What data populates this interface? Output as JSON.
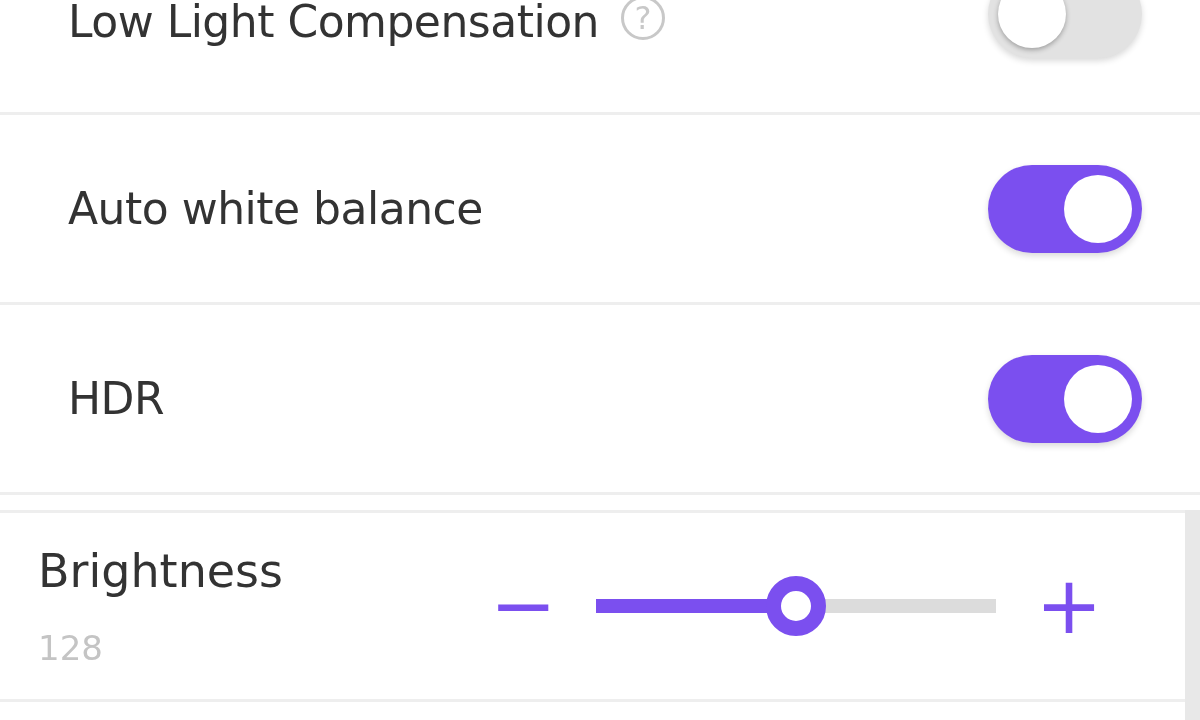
{
  "settings": [
    {
      "label": "Low Light Compensation",
      "help": "?",
      "on": false
    },
    {
      "label": "Auto white balance",
      "on": true
    },
    {
      "label": "HDR",
      "on": true
    }
  ],
  "brightness": {
    "label": "Brightness",
    "reading": "128",
    "minus": "−",
    "plus": "+",
    "level": 0.5
  }
}
